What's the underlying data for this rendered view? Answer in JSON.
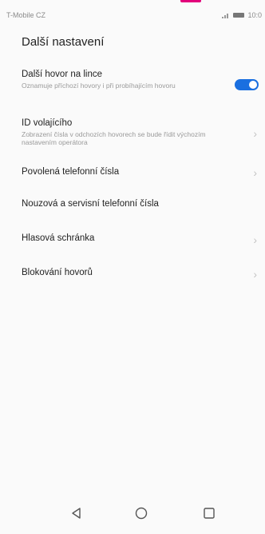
{
  "status_bar": {
    "carrier": "T-Mobile CZ",
    "time": "10:0"
  },
  "header": {
    "title": "Další nastavení"
  },
  "settings": [
    {
      "title": "Další hovor na lince",
      "subtitle": "Oznamuje příchozí hovory i při probíhajícím hovoru",
      "control": "toggle",
      "toggle_on": true
    },
    {
      "title": "ID volajícího",
      "subtitle": "Zobrazení čísla v odchozích hovorech se bude řídit výchozím nastavením operátora",
      "control": "chevron"
    },
    {
      "title": "Povolená telefonní čísla",
      "control": "chevron"
    },
    {
      "title": "Nouzová a servisní telefonní čísla",
      "control": "none"
    },
    {
      "title": "Hlasová schránka",
      "control": "chevron"
    },
    {
      "title": "Blokování hovorů",
      "control": "chevron"
    }
  ],
  "icons": {
    "chevron": "chevron-right-icon",
    "nav_back": "back-triangle-icon",
    "nav_home": "home-circle-icon",
    "nav_recents": "recents-square-icon"
  },
  "colors": {
    "toggle_on": "#1a6fe0",
    "accent": "#e2007a"
  }
}
